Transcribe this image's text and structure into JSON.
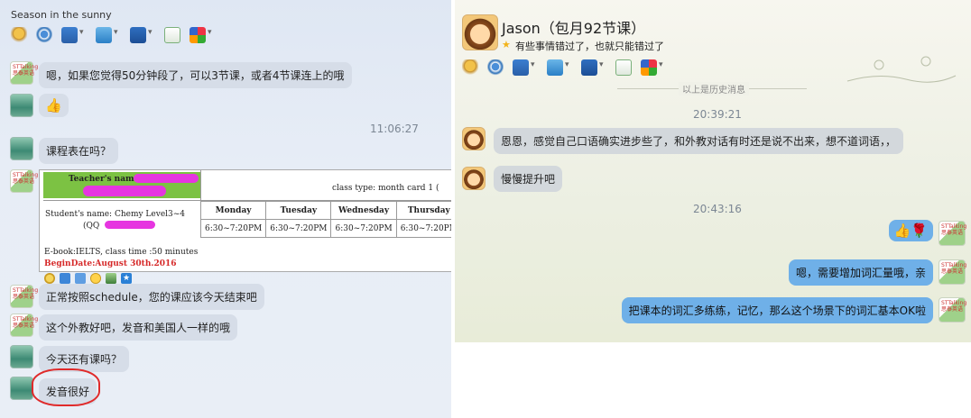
{
  "left": {
    "window_title": "Season in the sunny",
    "sender_badge": "STTalking\n思泰英语",
    "messages": [
      {
        "text": "嗯，如果您觉得50分钟段了，可以3节课，或者4节课连上的哦"
      },
      {
        "text": "👍"
      },
      {
        "timestamp": "11:06:27"
      },
      {
        "text": "课程表在吗？"
      },
      {
        "text": "正常按照schedule，您的课应该今天结束吧"
      },
      {
        "text": "这个外教好吧，发音和美国人一样的哦"
      },
      {
        "text": "今天还有课吗？"
      },
      {
        "text": "发音很好"
      }
    ],
    "schedule": {
      "teacher_label": "Teacher's name",
      "class_type": "class type: month card 1 (",
      "student_label": "Student's name: Chemy Level3~4",
      "qq_label": "(QQ",
      "days": [
        "Monday",
        "Tuesday",
        "Wednesday",
        "Thursday"
      ],
      "times": [
        "6:30~7:20PM",
        "6:30~7:20PM",
        "6:30~7:20PM",
        "6:30~7:20PM"
      ],
      "ebook": "E-book:IELTS, class time :50 minutes",
      "begin_date": "BeginDate:August 30th.2016"
    }
  },
  "right": {
    "contact_name": "Jason（包月92节课）",
    "status_text": "有些事情错过了，也就只能错过了",
    "history_divider": "以上是历史消息",
    "sender_badge": "STTalking\n思泰英语",
    "messages": [
      {
        "timestamp": "20:39:21"
      },
      {
        "text": "恩恩，感觉自己口语确实进步些了，和外教对话有时还是说不出来，想不道词语，，"
      },
      {
        "text": "慢慢提升吧"
      },
      {
        "timestamp": "20:43:16"
      },
      {
        "text": "👍🌹"
      },
      {
        "text": "嗯，需要增加词汇量哦，亲"
      },
      {
        "text": "把课本的词汇多练练，记忆，那么这个场景下的词汇基本OK啦"
      }
    ]
  },
  "toolbar_icons": [
    "microphone-icon",
    "webcam-icon",
    "screen-share-icon",
    "send-file-icon",
    "remote-assist-icon",
    "document-icon",
    "apps-icon"
  ],
  "colors": {
    "highlight": "#e635e0",
    "annotation_red": "#e02a2a",
    "blue_bubble": "#6fb0e8"
  }
}
